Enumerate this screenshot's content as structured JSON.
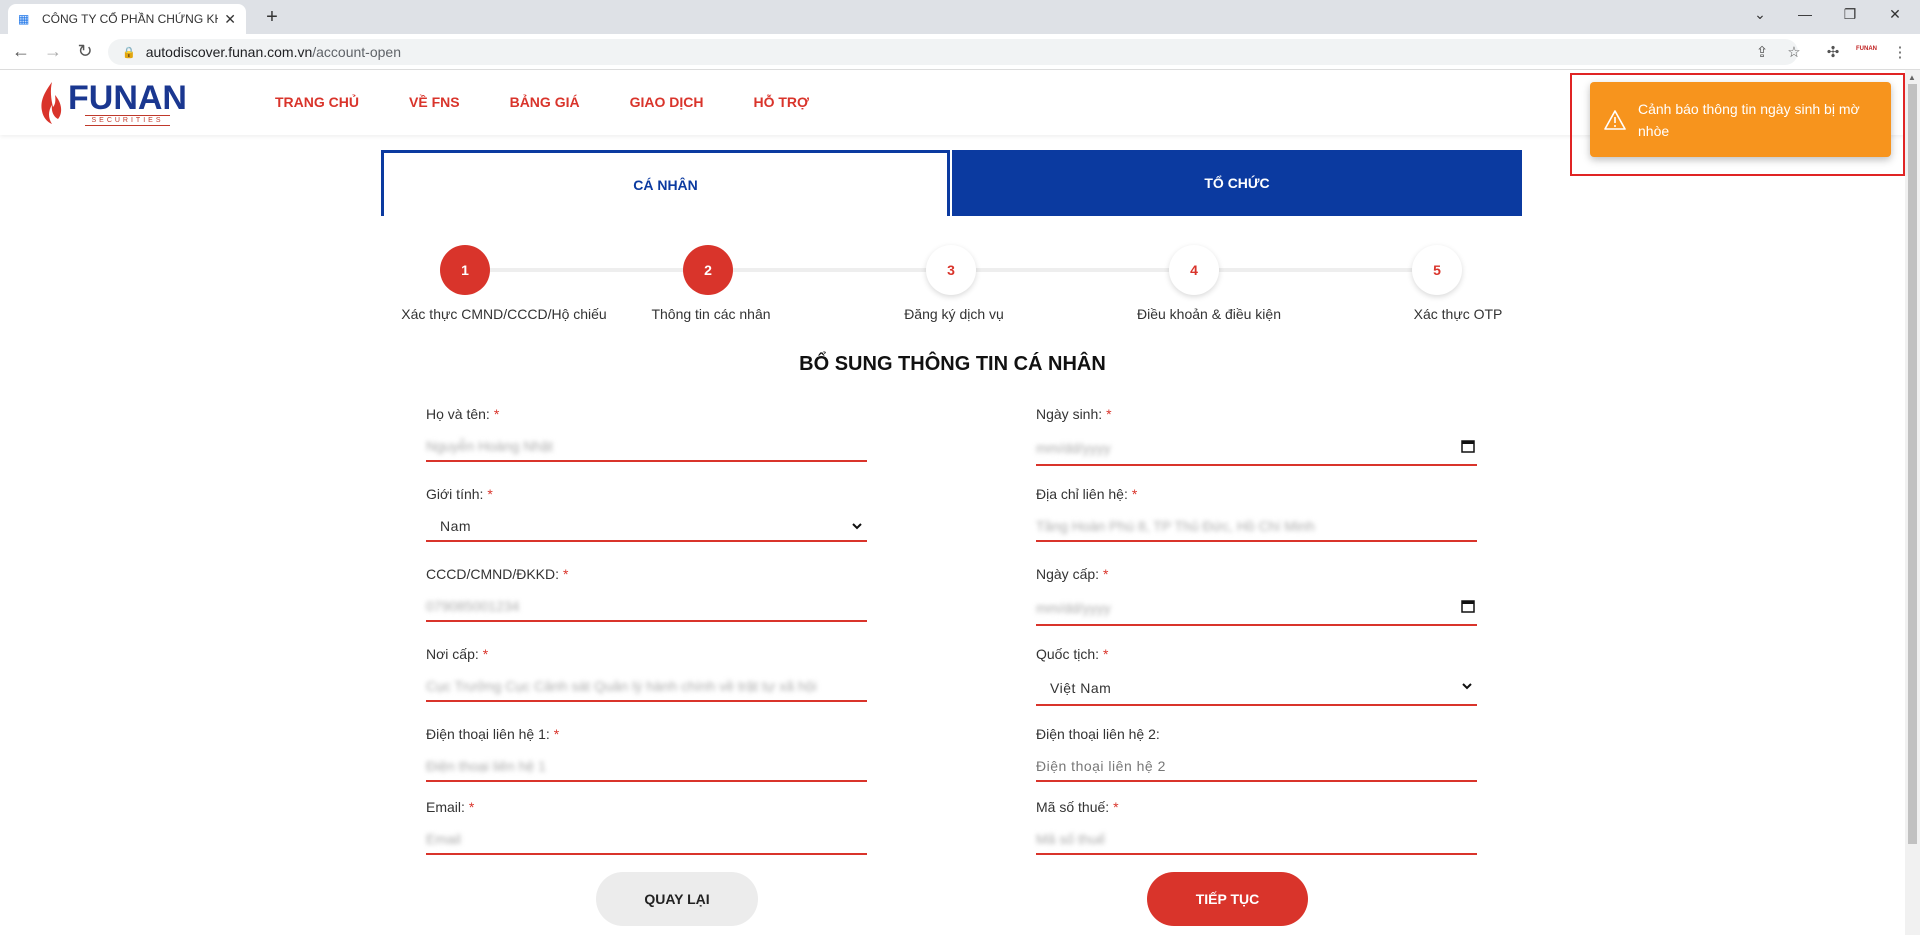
{
  "browser": {
    "tab_title": "CÔNG TY CỔ PHẦN CHỨNG KHO",
    "url_host": "autodiscover.funan.com.vn",
    "url_path": "/account-open",
    "extension_label": "FUNAN"
  },
  "site": {
    "logo_name": "FUNAN",
    "logo_sub": "SECURITIES",
    "menu": [
      "TRANG CHỦ",
      "VỀ FNS",
      "BẢNG GIÁ",
      "GIAO DỊCH",
      "HỖ TRỢ"
    ]
  },
  "toast": {
    "message": "Cảnh báo thông tin ngày sinh bị mờ nhòe",
    "color": "#f7941d"
  },
  "customer_tabs": {
    "individual": "CÁ NHÂN",
    "organization": "TỔ CHỨC"
  },
  "steps": [
    {
      "number": "1",
      "label": "Xác thực CMND/CCCD/Hộ chiếu",
      "status": "done"
    },
    {
      "number": "2",
      "label": "Thông tin các nhân",
      "status": "current"
    },
    {
      "number": "3",
      "label": "Đăng ký dịch vụ",
      "status": "todo"
    },
    {
      "number": "4",
      "label": "Điều khoản & điều kiện",
      "status": "todo"
    },
    {
      "number": "5",
      "label": "Xác thực OTP",
      "status": "todo"
    }
  ],
  "form": {
    "title": "BỔ SUNG THÔNG TIN CÁ NHÂN",
    "full_name": {
      "label": "Họ và tên:",
      "value": "Nguyễn Hoàng Nhật"
    },
    "dob": {
      "label": "Ngày sinh:",
      "value": "mm/dd/yyyy"
    },
    "gender": {
      "label": "Giới tính:",
      "value": "Nam"
    },
    "address": {
      "label": "Địa chỉ liên hệ:",
      "value": "Tầng Hoàn Phú 8, TP Thủ Đức, Hồ Chí Minh"
    },
    "id_number": {
      "label": "CCCD/CMND/ĐKKD:",
      "value": "079085001234"
    },
    "issue_date": {
      "label": "Ngày cấp:",
      "value": "mm/dd/yyyy"
    },
    "issue_place": {
      "label": "Nơi cấp:",
      "value": "Cục Trưởng Cục Cảnh sát Quản lý hành chính về trật tự xã hội"
    },
    "nationality": {
      "label": "Quốc tịch:",
      "value": "Việt Nam"
    },
    "phone1": {
      "label": "Điện thoại liên hệ 1:",
      "value": "Điện thoại liên hệ 1"
    },
    "phone2": {
      "label": "Điện thoại liên hệ 2:",
      "placeholder": "Điện thoại liên hệ 2"
    },
    "email": {
      "label": "Email:",
      "value": "Email"
    },
    "tax_code": {
      "label": "Mã số thuế:",
      "value": "Mã số thuế"
    },
    "required_mark": "*"
  },
  "buttons": {
    "back": "QUAY LẠI",
    "next": "TIẾP TỤC"
  },
  "colors": {
    "primary_red": "#d9342b",
    "primary_blue": "#0b3aa0",
    "warning_orange": "#f7941d"
  }
}
